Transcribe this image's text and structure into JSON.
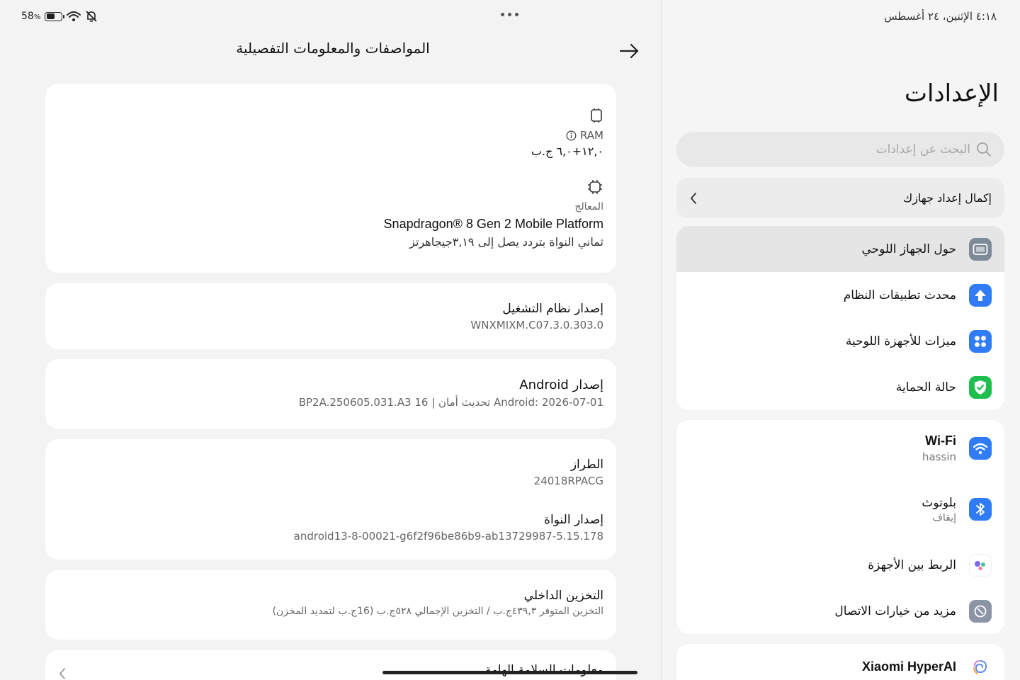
{
  "status": {
    "battery_percent": "58",
    "battery_unit": "%",
    "battery_level": 0.58,
    "datetime": "٤:١٨  الإثنين، ٢٤ أغسطس"
  },
  "detail": {
    "title": "المواصفات والمعلومات التفصيلية",
    "ram_label": "RAM",
    "ram_value": "١٢,٠+٦,٠ ج.ب",
    "processor_label": "المعالج",
    "processor_name": "Snapdragon® 8 Gen 2 Mobile Platform",
    "processor_desc": "ثماني النواة بتردد يصل إلى ٣,١٩جيجاهرتز",
    "os_label": "إصدار نظام التشغيل",
    "os_value": "WNXMIXM.C07.3.0.303.0",
    "android_label": "إصدار Android",
    "android_value": "Android: 2026-07-01 تحديث أمان | BP2A.250605.031.A3 16",
    "model_label": "الطراز",
    "model_value": "24018RPACG",
    "kernel_label": "إصدار النواة",
    "kernel_value": "android13-8-00021-g6f2f96be86b9-ab13729987-5.15.178",
    "storage_label": "التخزين الداخلي",
    "storage_value": "التخزين المتوفر ٤٣٩,٣ج.ب / التخزين الإجمالي ٥٢٨ج.ب (16ج.ب لتمديد المخزن)",
    "safety_label": "معلومات السلامة الهامة"
  },
  "settings": {
    "title": "الإعدادات",
    "search_placeholder": "البحث عن إعدادات",
    "setup_label": "إكمال إعداد جهازك",
    "items": [
      {
        "label": "حول الجهاز اللوحي",
        "icon": "tablet-icon",
        "color": "#7f8a99"
      },
      {
        "label": "محدث تطبيقات النظام",
        "icon": "upload-arrow-icon",
        "color": "#2f7cf6"
      },
      {
        "label": "ميزات للأجهزة اللوحية",
        "icon": "grid-dots-icon",
        "color": "#2f7cf6"
      },
      {
        "label": "حالة الحماية",
        "icon": "shield-check-icon",
        "color": "#1fbf4f"
      }
    ],
    "connectivity": [
      {
        "label": "Wi-Fi",
        "sub": "hassin",
        "icon": "wifi-icon",
        "color": "#2f7cf6"
      },
      {
        "label": "بلوتوث",
        "sub": "إيقاف",
        "icon": "bluetooth-icon",
        "color": "#2f7cf6"
      },
      {
        "label": "الربط بين الأجهزة",
        "icon": "device-link-icon",
        "color": "#ffffff"
      },
      {
        "label": "مزيد من خيارات الاتصال",
        "icon": "link-icon",
        "color": "#8b95a5"
      }
    ],
    "ai_label": "Xiaomi HyperAI"
  }
}
